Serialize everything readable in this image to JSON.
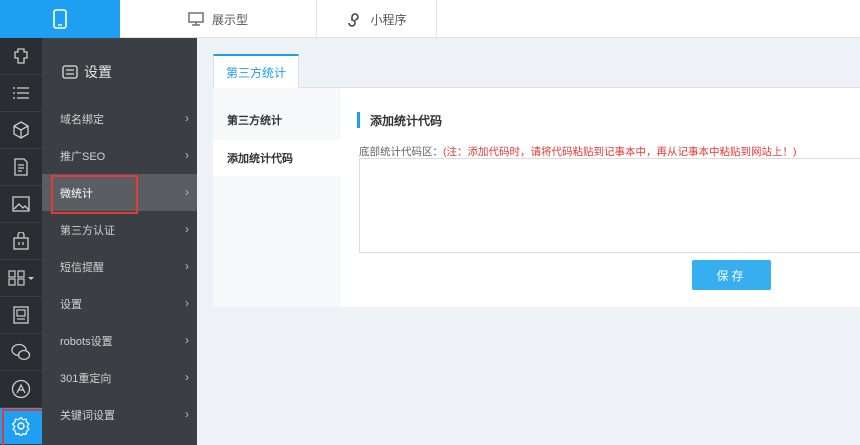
{
  "topbar": {
    "device_icon": "mobile-phone-icon",
    "tabs": [
      {
        "label": "展示型",
        "icon": "monitor-icon"
      },
      {
        "label": "小程序",
        "icon": "mini-program-icon"
      }
    ]
  },
  "rail": {
    "items": [
      {
        "icon": "puzzle-icon"
      },
      {
        "icon": "list-icon"
      },
      {
        "icon": "cube-icon"
      },
      {
        "icon": "document-icon"
      },
      {
        "icon": "image-icon"
      },
      {
        "icon": "shopping-bag-icon"
      },
      {
        "icon": "apps-grid-icon"
      },
      {
        "icon": "form-icon"
      },
      {
        "icon": "wechat-icon"
      },
      {
        "icon": "app-store-icon"
      },
      {
        "icon": "settings-icon",
        "active": true
      }
    ]
  },
  "submenu": {
    "title": "设置",
    "items": [
      {
        "label": "域名绑定"
      },
      {
        "label": "推广SEO"
      },
      {
        "label": "微统计",
        "active": true
      },
      {
        "label": "第三方认证"
      },
      {
        "label": "短信提醒"
      },
      {
        "label": "设置"
      },
      {
        "label": "robots设置"
      },
      {
        "label": "301重定向"
      },
      {
        "label": "关键词设置"
      }
    ]
  },
  "main": {
    "tab_label": "第三方统计",
    "subnav": [
      {
        "label": "第三方统计"
      },
      {
        "label": "添加统计代码",
        "active": true
      }
    ],
    "section_title": "添加统计代码",
    "field_label": "底部统计代码区：",
    "field_note": "(注：添加代码时，请将代码粘贴到记事本中，再从记事本中粘贴到网站上！)",
    "code_value": "",
    "save_label": "保存"
  },
  "colors": {
    "accent": "#1e9ff2",
    "highlight_box": "#e53935",
    "rail_bg": "#2a2d31",
    "submenu_bg": "#3b3e42"
  }
}
